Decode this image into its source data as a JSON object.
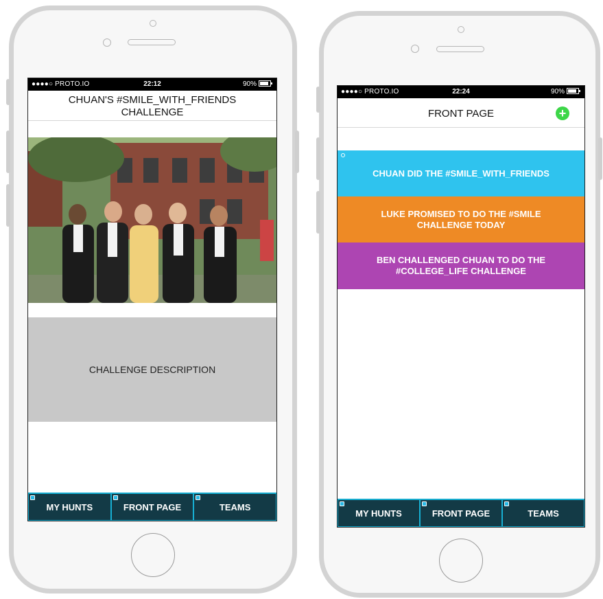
{
  "left_phone": {
    "status": {
      "carrier": "●●●●○ PROTO.IO",
      "time": "22:12",
      "battery": "90%"
    },
    "title_line1": "CHUAN'S #SMILE_WITH_FRIENDS",
    "title_line2": "CHALLENGE",
    "description": "CHALLENGE DESCRIPTION",
    "tabs": [
      {
        "label": "MY HUNTS"
      },
      {
        "label": "FRONT PAGE"
      },
      {
        "label": "TEAMS"
      }
    ]
  },
  "right_phone": {
    "status": {
      "carrier": "●●●●○ PROTO.IO",
      "time": "22:24",
      "battery": "90%"
    },
    "title": "FRONT PAGE",
    "add_icon": "+",
    "feed": [
      {
        "text": "CHUAN DID THE #SMILE_WITH_FRIENDS",
        "color": "#2fc3ee"
      },
      {
        "text": "LUKE PROMISED TO DO THE #SMILE CHALLENGE TODAY",
        "color": "#ee8a25"
      },
      {
        "text": "BEN CHALLENGED CHUAN TO DO THE #COLLEGE_LIFE CHALLENGE",
        "color": "#ad45b2"
      }
    ],
    "tabs": [
      {
        "label": "MY HUNTS"
      },
      {
        "label": "FRONT PAGE"
      },
      {
        "label": "TEAMS"
      }
    ]
  },
  "colors": {
    "tabbar": "#133a46",
    "tab_border": "#17b0d4",
    "add": "#3dd648"
  }
}
